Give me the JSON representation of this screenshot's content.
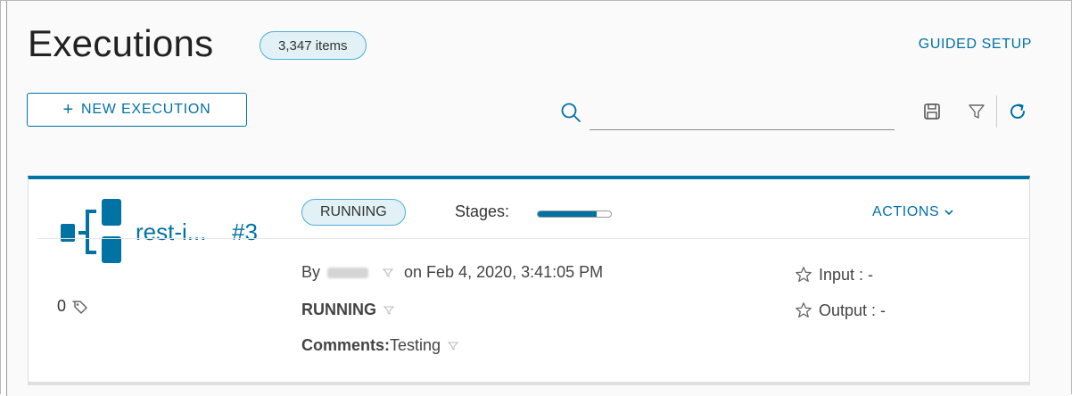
{
  "header": {
    "title": "Executions",
    "count_badge": "3,347 items",
    "guided_setup": "GUIDED SETUP"
  },
  "toolbar": {
    "new_execution": "NEW EXECUTION",
    "search_placeholder": "",
    "icons": [
      "search-icon",
      "save-icon",
      "filter-icon",
      "refresh-icon"
    ]
  },
  "execution": {
    "pipeline_name": "rest-i...",
    "run_number": "#3",
    "tag_count": "0",
    "status_badge": "RUNNING",
    "stages_label": "Stages:",
    "stages_progress": 0.8,
    "actions": "ACTIONS",
    "by_label": "By",
    "started": "on Feb 4, 2020, 3:41:05 PM",
    "status": "RUNNING",
    "comments_label": "Comments:",
    "comments_value": "Testing",
    "input": "Input : -",
    "output": "Output : -"
  },
  "colors": {
    "accent": "#0072a3",
    "badge_bg": "#e1f1f6",
    "badge_border": "#49afd9"
  }
}
